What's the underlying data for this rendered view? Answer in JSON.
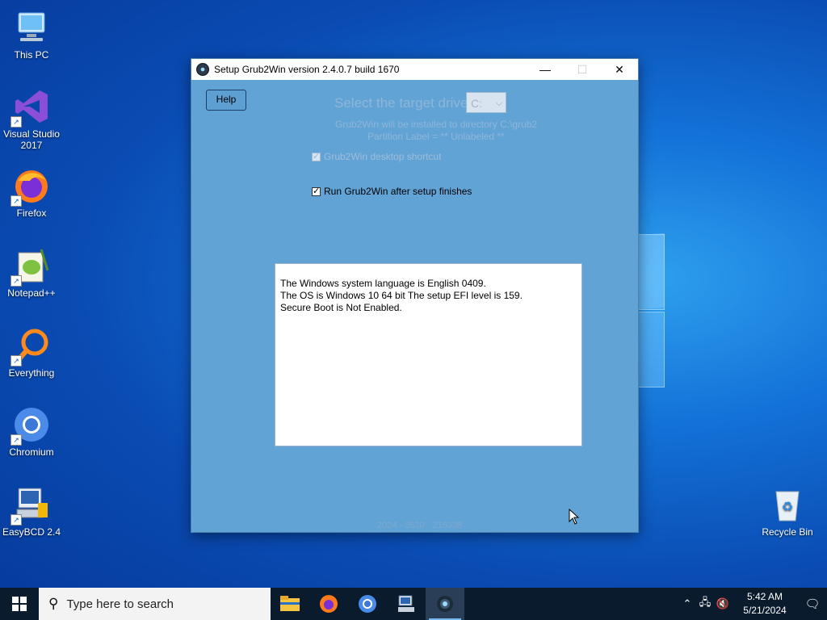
{
  "desktop": {
    "icons": [
      {
        "label": "This PC"
      },
      {
        "label": "Visual Studio 2017"
      },
      {
        "label": "Firefox"
      },
      {
        "label": "Notepad++"
      },
      {
        "label": "Everything"
      },
      {
        "label": "Chromium"
      },
      {
        "label": "EasyBCD 2.4"
      },
      {
        "label": "Recycle Bin"
      }
    ]
  },
  "window": {
    "title": "Setup Grub2Win version 2.4.0.7 build 1670",
    "minimize": "—",
    "maximize": "☐",
    "close": "✕",
    "help_label": "Help",
    "target_label": "Select the target drive",
    "drive_value": "C:",
    "install_dir": "Grub2Win will be installed to directory C:\\grub2",
    "partition_label": "Partition Label = ** Unlabeled **",
    "desktop_shortcut_label": "Grub2Win desktop shortcut",
    "desktop_shortcut_checked": true,
    "run_after_label": "Run Grub2Win after setup finishes",
    "run_after_checked": true,
    "info_lines": [
      "The Windows system language is English   0409.",
      "The OS is Windows 10   64 bit   The setup EFI level is 159.",
      "Secure Boot is Not Enabled."
    ],
    "footer_stamp": "2024 - 0520 - 215338"
  },
  "taskbar": {
    "search_placeholder": "Type here to search",
    "apps": [
      "file-explorer",
      "firefox",
      "chromium",
      "easybcd",
      "grub2win"
    ],
    "clock_time": "5:42 AM",
    "clock_date": "5/21/2024"
  },
  "colors": {
    "window_bg": "#62a3d6",
    "taskbar_bg": "#0b1b2e"
  }
}
